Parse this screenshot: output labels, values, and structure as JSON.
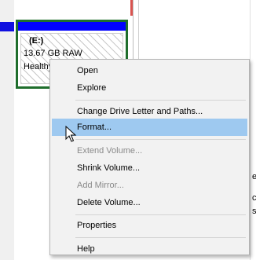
{
  "partition": {
    "letter": "(E:)",
    "size": "13.67 GB RAW",
    "status": "Healthy",
    "bar_color": "#0000ff",
    "border_color": "#1f6e2c"
  },
  "context_menu": {
    "items": [
      {
        "label": "Open",
        "enabled": true
      },
      {
        "label": "Explore",
        "enabled": true
      },
      {
        "label": "Change Drive Letter and Paths...",
        "enabled": true
      },
      {
        "label": "Format...",
        "enabled": true,
        "highlighted": true
      },
      {
        "label": "Extend Volume...",
        "enabled": false
      },
      {
        "label": "Shrink Volume...",
        "enabled": true
      },
      {
        "label": "Add Mirror...",
        "enabled": false
      },
      {
        "label": "Delete Volume...",
        "enabled": true
      },
      {
        "label": "Properties",
        "enabled": true
      },
      {
        "label": "Help",
        "enabled": true
      }
    ],
    "highlight_color": "#9ec9f0"
  },
  "icons": {
    "cursor": "mouse-pointer-icon"
  }
}
